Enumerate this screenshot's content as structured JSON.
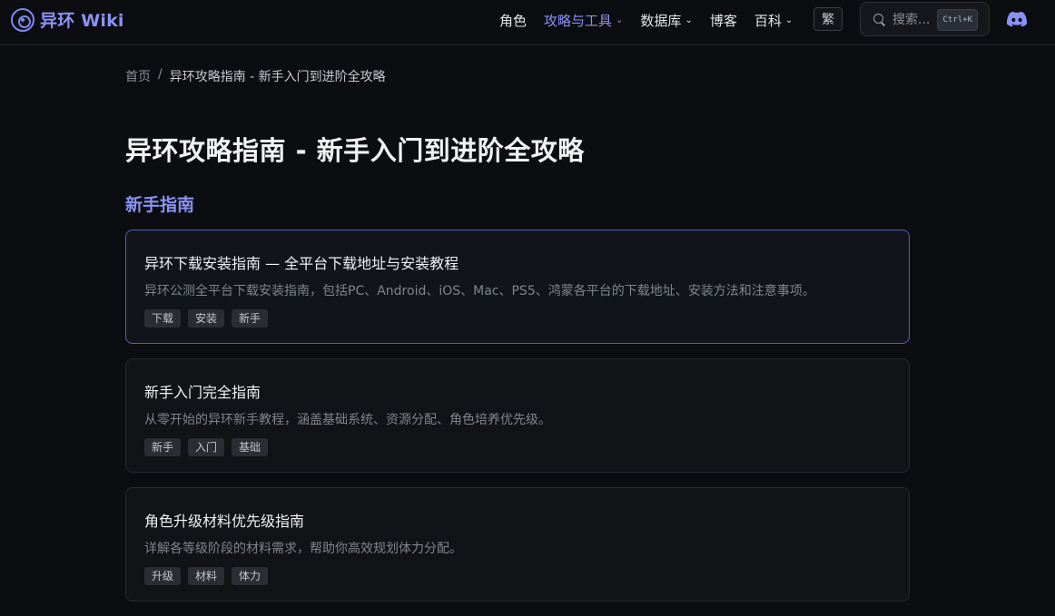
{
  "header": {
    "logo_text": "异环 Wiki",
    "nav": [
      {
        "label": "角色",
        "dropdown": false,
        "active": false
      },
      {
        "label": "攻略与工具",
        "dropdown": true,
        "active": true
      },
      {
        "label": "数据库",
        "dropdown": true,
        "active": false
      },
      {
        "label": "博客",
        "dropdown": false,
        "active": false
      },
      {
        "label": "百科",
        "dropdown": true,
        "active": false
      }
    ],
    "traditional_toggle": "繁",
    "search": {
      "placeholder": "搜索...",
      "shortcut": "Ctrl+K"
    },
    "accent_color": "#8b92f5"
  },
  "breadcrumb": {
    "home": "首页",
    "separator": "/",
    "current": "异环攻略指南 - 新手入门到进阶全攻略"
  },
  "page_title": "异环攻略指南 - 新手入门到进阶全攻略",
  "section": {
    "title": "新手指南",
    "cards": [
      {
        "title": "异环下载安装指南 — 全平台下载地址与安装教程",
        "desc": "异环公测全平台下载安装指南，包括PC、Android、iOS、Mac、PS5、鸿蒙各平台的下载地址、安装方法和注意事项。",
        "tags": [
          "下载",
          "安装",
          "新手"
        ]
      },
      {
        "title": "新手入门完全指南",
        "desc": "从零开始的异环新手教程，涵盖基础系统、资源分配、角色培养优先级。",
        "tags": [
          "新手",
          "入门",
          "基础"
        ]
      },
      {
        "title": "角色升级材料优先级指南",
        "desc": "详解各等级阶段的材料需求，帮助你高效规划体力分配。",
        "tags": [
          "升级",
          "材料",
          "体力"
        ]
      }
    ]
  }
}
